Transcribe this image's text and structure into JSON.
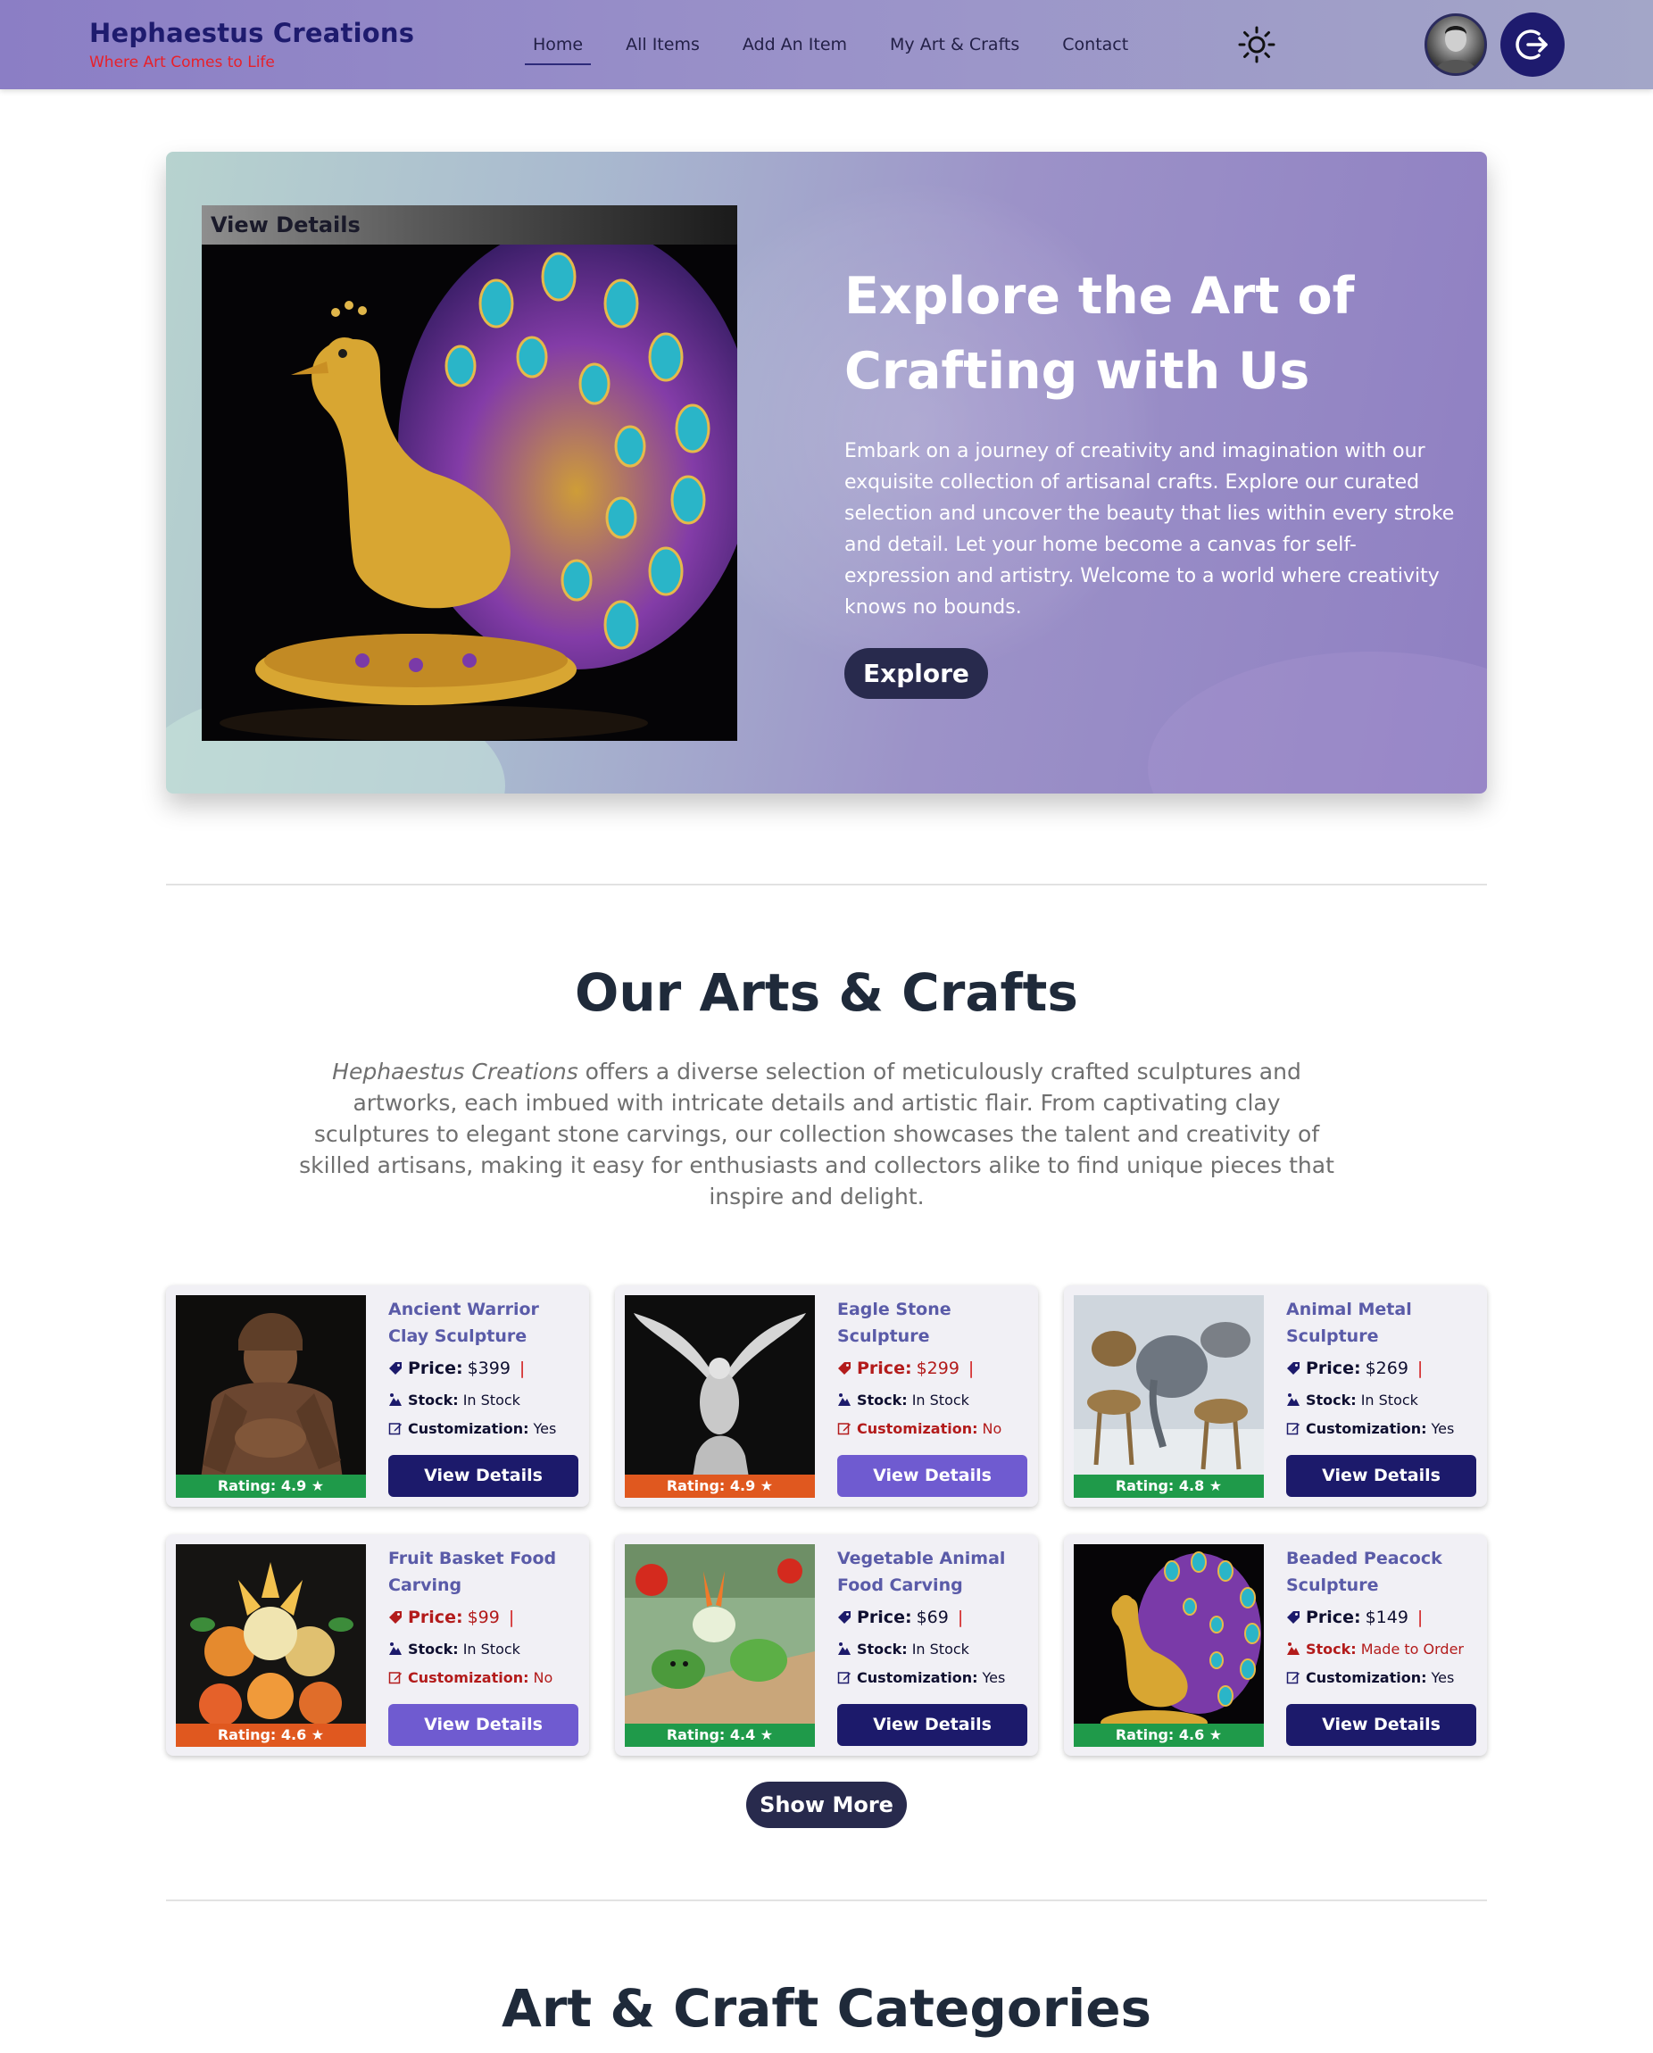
{
  "brand": {
    "title": "Hephaestus Creations",
    "tagline": "Where Art Comes to Life"
  },
  "nav": {
    "items": [
      "Home",
      "All Items",
      "Add An Item",
      "My Art & Crafts",
      "Contact"
    ],
    "active": "Home"
  },
  "hero": {
    "image_label": "View Details",
    "title": "Explore the Art of Crafting with Us",
    "description": "Embark on a journey of creativity and imagination with our exquisite collection of artisanal crafts. Explore our curated selection and uncover the beauty that lies within every stroke and detail. Let your home become a canvas for self-expression and artistry. Welcome to a world where creativity knows no bounds.",
    "button": "Explore"
  },
  "section": {
    "title": "Our Arts & Crafts",
    "description_brand": "Hephaestus Creations",
    "description_rest": " offers a diverse selection of meticulously crafted sculptures and artworks, each imbued with intricate details and artistic flair. From captivating clay sculptures to elegant stone carvings, our collection showcases the talent and creativity of skilled artisans, making it easy for enthusiasts and collectors alike to find unique pieces that inspire and delight."
  },
  "labels": {
    "price": "Price:",
    "stock": "Stock:",
    "customization": "Customization:",
    "view": "View Details",
    "separator": "|"
  },
  "colors": {
    "rating_green": "#1f9a4a",
    "rating_orange": "#e0581f",
    "btn_navy": "#1c1a6b",
    "btn_purple": "#6f5bd0"
  },
  "items": [
    {
      "title": "Ancient Warrior Clay Sculpture",
      "price": "$399",
      "stock": "In Stock",
      "customization": "Yes",
      "rating": "Rating: 4.9 ★"
    },
    {
      "title": "Eagle Stone Sculpture",
      "price": "$299",
      "stock": "In Stock",
      "customization": "No",
      "rating": "Rating: 4.9 ★"
    },
    {
      "title": "Animal Metal Sculpture",
      "price": "$269",
      "stock": "In Stock",
      "customization": "Yes",
      "rating": "Rating: 4.8 ★"
    },
    {
      "title": "Fruit Basket Food Carving",
      "price": "$99",
      "stock": "In Stock",
      "customization": "No",
      "rating": "Rating: 4.6 ★"
    },
    {
      "title": "Vegetable Animal Food Carving",
      "price": "$69",
      "stock": "In Stock",
      "customization": "Yes",
      "rating": "Rating: 4.4 ★"
    },
    {
      "title": "Beaded Peacock Sculpture",
      "price": "$149",
      "stock": "Made to Order",
      "customization": "Yes",
      "rating": "Rating: 4.6 ★"
    }
  ],
  "show_more": "Show More",
  "categories": {
    "title": "Art & Craft Categories"
  }
}
